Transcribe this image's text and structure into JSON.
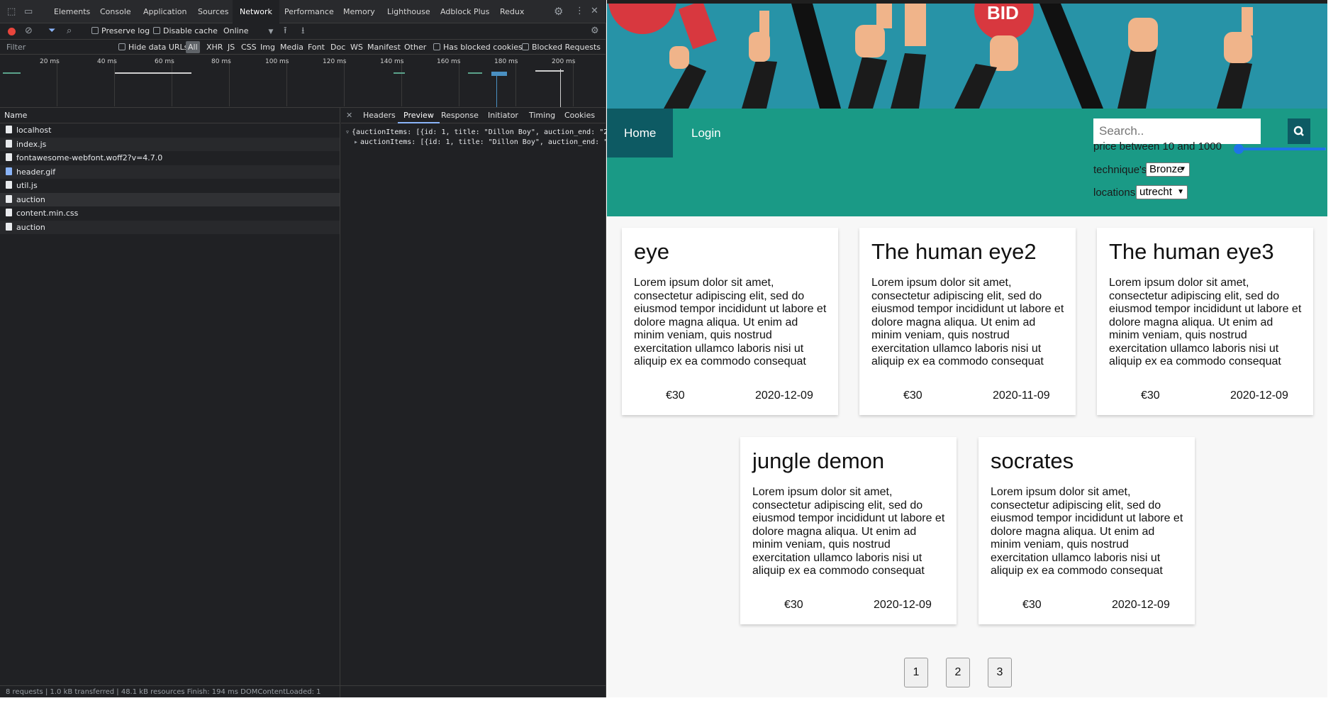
{
  "devtools": {
    "tabs": [
      "Elements",
      "Console",
      "Application",
      "Sources",
      "Network",
      "Performance",
      "Memory",
      "Lighthouse",
      "Adblock Plus",
      "Redux"
    ],
    "active_tab": "Network",
    "toolbar": {
      "preserve_log": "Preserve log",
      "disable_cache": "Disable cache",
      "throttle": "Online"
    },
    "filterbar": {
      "filter_placeholder": "Filter",
      "hide_data_urls": "Hide data URLs",
      "types": [
        "All",
        "XHR",
        "JS",
        "CSS",
        "Img",
        "Media",
        "Font",
        "Doc",
        "WS",
        "Manifest",
        "Other"
      ],
      "has_blocked_cookies": "Has blocked cookies",
      "blocked_requests": "Blocked Requests"
    },
    "overview_ticks": [
      "20 ms",
      "40 ms",
      "60 ms",
      "80 ms",
      "100 ms",
      "120 ms",
      "140 ms",
      "160 ms",
      "180 ms",
      "200 ms"
    ],
    "name_header": "Name",
    "requests": [
      {
        "name": "localhost",
        "icon": "document-icon"
      },
      {
        "name": "index.js",
        "icon": "document-icon"
      },
      {
        "name": "fontawesome-webfont.woff2?v=4.7.0",
        "icon": "document-icon"
      },
      {
        "name": "header.gif",
        "icon": "image-file-icon"
      },
      {
        "name": "util.js",
        "icon": "document-icon"
      },
      {
        "name": "auction",
        "icon": "document-icon"
      },
      {
        "name": "content.min.css",
        "icon": "document-icon"
      },
      {
        "name": "auction",
        "icon": "document-icon"
      }
    ],
    "detail_tabs": [
      "Headers",
      "Preview",
      "Response",
      "Initiator",
      "Timing",
      "Cookies"
    ],
    "active_detail_tab": "Preview",
    "preview_lines": [
      "{auctionItems: [{id: 1, title: \"Dillon Boy\", auction_end: \"2",
      "auctionItems: [{id: 1, title: \"Dillon Boy\", auction_end: \""
    ],
    "status_text": "8 requests | 1.0 kB transferred | 48.1 kB resources   Finish: 194 ms   DOMContentLoaded: 1"
  },
  "page": {
    "nav": {
      "home": "Home",
      "login": "Login"
    },
    "search": {
      "placeholder": "Search.."
    },
    "price_label": "price between 10 and 1000",
    "price_range": {
      "min_fraction": 0.0,
      "max_fraction": 1.0
    },
    "technique_label": "technique's:",
    "technique_value": "Bronze",
    "locations_label": "locations:",
    "locations_value": "utrecht",
    "cards": [
      {
        "title": "eye",
        "text": "Lorem ipsum dolor sit amet, consectetur adipiscing elit, sed do eiusmod tempor incididunt ut labore et dolore magna aliqua. Ut enim ad minim veniam, quis nostrud exercitation ullamco laboris nisi ut aliquip ex ea commodo consequat",
        "price": "€30",
        "date": "2020-12-09"
      },
      {
        "title": "The human eye2",
        "text": "Lorem ipsum dolor sit amet, consectetur adipiscing elit, sed do eiusmod tempor incididunt ut labore et dolore magna aliqua. Ut enim ad minim veniam, quis nostrud exercitation ullamco laboris nisi ut aliquip ex ea commodo consequat",
        "price": "€30",
        "date": "2020-11-09"
      },
      {
        "title": "The human eye3",
        "text": "Lorem ipsum dolor sit amet, consectetur adipiscing elit, sed do eiusmod tempor incididunt ut labore et dolore magna aliqua. Ut enim ad minim veniam, quis nostrud exercitation ullamco laboris nisi ut aliquip ex ea commodo consequat",
        "price": "€30",
        "date": "2020-12-09"
      },
      {
        "title": "jungle demon",
        "text": "Lorem ipsum dolor sit amet, consectetur adipiscing elit, sed do eiusmod tempor incididunt ut labore et dolore magna aliqua. Ut enim ad minim veniam, quis nostrud exercitation ullamco laboris nisi ut aliquip ex ea commodo consequat",
        "price": "€30",
        "date": "2020-12-09"
      },
      {
        "title": "socrates",
        "text": "Lorem ipsum dolor sit amet, consectetur adipiscing elit, sed do eiusmod tempor incididunt ut labore et dolore magna aliqua. Ut enim ad minim veniam, quis nostrud exercitation ullamco laboris nisi ut aliquip ex ea commodo consequat",
        "price": "€30",
        "date": "2020-12-09"
      }
    ],
    "pages": [
      "1",
      "2",
      "3"
    ],
    "colors": {
      "navbar": "#1a9a86",
      "nav_active": "#0d5a63",
      "hero": "#2793a7",
      "slider": "#1e73e8"
    }
  }
}
